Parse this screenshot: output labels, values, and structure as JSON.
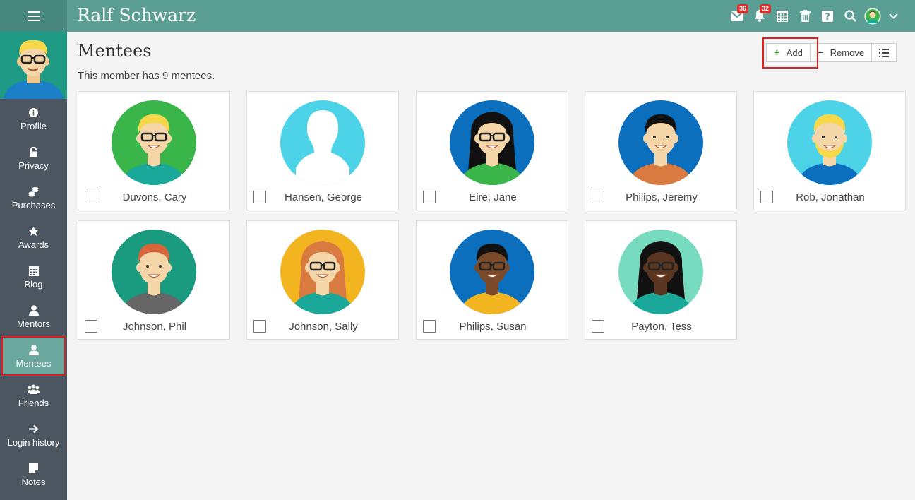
{
  "app": {
    "title": "Ralf Schwarz"
  },
  "topbar": {
    "messages_badge": "36",
    "notifications_badge": "32"
  },
  "sidebar": {
    "items": [
      {
        "label": "Profile",
        "icon": "info-icon"
      },
      {
        "label": "Privacy",
        "icon": "lock-icon"
      },
      {
        "label": "Purchases",
        "icon": "coins-icon"
      },
      {
        "label": "Awards",
        "icon": "star-icon"
      },
      {
        "label": "Blog",
        "icon": "calendar-icon"
      },
      {
        "label": "Mentors",
        "icon": "person-icon"
      },
      {
        "label": "Mentees",
        "icon": "person-icon",
        "active": true
      },
      {
        "label": "Friends",
        "icon": "group-icon"
      },
      {
        "label": "Login history",
        "icon": "arrow-right-icon"
      },
      {
        "label": "Notes",
        "icon": "note-icon"
      }
    ]
  },
  "main": {
    "title": "Mentees",
    "subtitle": "This member has 9 mentees.",
    "actions": {
      "add": "Add",
      "remove": "Remove"
    },
    "mentees": [
      {
        "name": "Duvons, Cary",
        "bg": "#3ab54a",
        "skin": "#f5d6a8",
        "hair": "#f7d84a",
        "shirt": "#1aa89a",
        "glasses": true
      },
      {
        "name": "Hansen, George",
        "bg": "#4cd3e8",
        "silhouette": true
      },
      {
        "name": "Eire, Jane",
        "bg": "#0b6fbe",
        "skin": "#f5d6a8",
        "hair": "#111111",
        "shirt": "#3ab54a",
        "glasses": true
      },
      {
        "name": "Philips, Jeremy",
        "bg": "#0b6fbe",
        "skin": "#f5d6a8",
        "hair": "#111111",
        "shirt": "#d97a40",
        "glasses": false
      },
      {
        "name": "Rob, Jonathan",
        "bg": "#4cd3e8",
        "skin": "#f5d6a8",
        "hair": "#f7d84a",
        "shirt": "#0b6fbe",
        "glasses": false
      },
      {
        "name": "Johnson, Phil",
        "bg": "#1a9a7e",
        "skin": "#f5d6a8",
        "hair": "#d9663a",
        "shirt": "#666666",
        "glasses": false
      },
      {
        "name": "Johnson, Sally",
        "bg": "#f2b41f",
        "skin": "#f5d6a8",
        "hair": "#d97a40",
        "shirt": "#1aa89a",
        "glasses": true
      },
      {
        "name": "Philips, Susan",
        "bg": "#0b6fbe",
        "skin": "#7a4a2a",
        "hair": "#111111",
        "shirt": "#f2b41f",
        "glasses": true
      },
      {
        "name": "Payton, Tess",
        "bg": "#76dbbf",
        "skin": "#5a3520",
        "hair": "#111111",
        "shirt": "#1aa89a",
        "glasses": true
      }
    ]
  }
}
